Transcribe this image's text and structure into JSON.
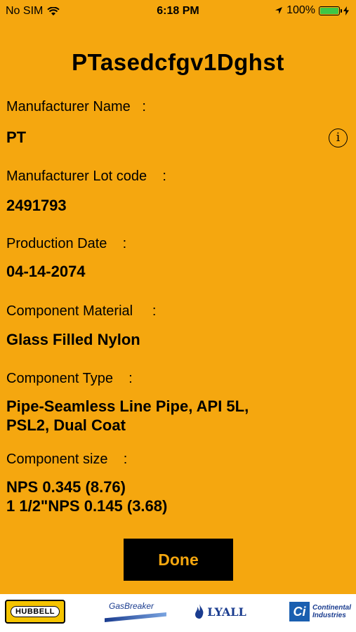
{
  "status_bar": {
    "carrier": "No SIM",
    "time": "6:18 PM",
    "battery_percent": "100%",
    "icons": [
      "wifi-icon",
      "location-arrow-icon",
      "battery-icon",
      "charging-bolt-icon"
    ]
  },
  "title": "PTasedcfgv1Dghst",
  "fields": [
    {
      "label": "Manufacturer Name   :",
      "value": "PT"
    },
    {
      "label": "Manufacturer Lot code    :",
      "value": "2491793"
    },
    {
      "label": "Production Date    :",
      "value": "04-14-2074"
    },
    {
      "label": "Component Material     :",
      "value": "Glass Filled Nylon"
    },
    {
      "label": "Component Type    :",
      "value": "Pipe-Seamless Line Pipe, API 5L,\nPSL2, Dual Coat"
    },
    {
      "label": "Component size    :",
      "value": "NPS 0.345 (8.76)\n1 1/2\"NPS 0.145 (3.68)"
    }
  ],
  "info_icon": "info-circle-icon",
  "done_label": "Done",
  "footer_logos": {
    "hubbell": "HUBBELL",
    "gasbreaker": "GasBreaker",
    "lyall": "LYALL",
    "continental_line1": "Continental",
    "continental_line2": "Industries"
  },
  "colors": {
    "background": "#F5A70F",
    "button_bg": "#000000",
    "button_text": "#F5A70F",
    "battery": "#3EC646"
  }
}
